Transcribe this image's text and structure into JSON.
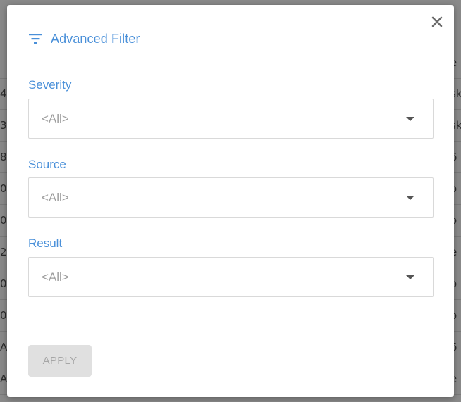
{
  "background": {
    "left_fragments": [
      "",
      "4",
      "3",
      "8",
      "0",
      "0",
      "2",
      "0",
      "0",
      "A",
      "A"
    ],
    "right_fragments": [
      "e",
      "sk",
      "sk",
      "6",
      "o",
      "o",
      "e",
      "o",
      "o",
      "6",
      "e"
    ]
  },
  "modal": {
    "title": "Advanced Filter",
    "title_icon": "filter-icon",
    "close_icon": "close-icon",
    "accent_color": "#4a90d9",
    "fields": [
      {
        "label": "Severity",
        "value": "<All>"
      },
      {
        "label": "Source",
        "value": "<All>"
      },
      {
        "label": "Result",
        "value": "<All>"
      }
    ],
    "apply_label": "APPLY",
    "apply_enabled": false
  }
}
